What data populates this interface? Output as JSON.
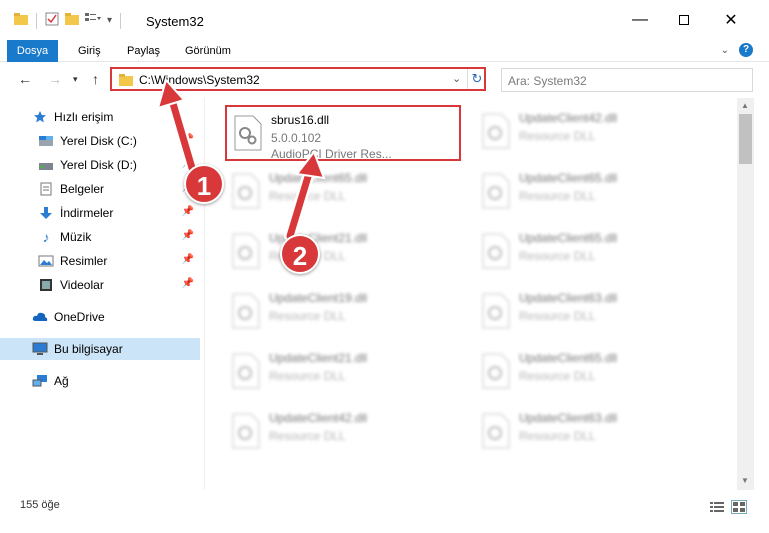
{
  "window": {
    "title": "System32"
  },
  "ribbon": {
    "tabs": [
      "Dosya",
      "Giriş",
      "Paylaş",
      "Görünüm"
    ],
    "help": "?"
  },
  "address": {
    "path": "C:\\Windows\\System32",
    "search_placeholder": "Ara: System32"
  },
  "sidebar": {
    "items": [
      {
        "label": "Hızlı erişim",
        "icon": "star-icon"
      },
      {
        "label": "Yerel Disk (C:)",
        "icon": "drive-icon"
      },
      {
        "label": "Yerel Disk (D:)",
        "icon": "drive-icon"
      },
      {
        "label": "Belgeler",
        "icon": "document-icon"
      },
      {
        "label": "İndirmeler",
        "icon": "download-icon"
      },
      {
        "label": "Müzik",
        "icon": "music-icon"
      },
      {
        "label": "Resimler",
        "icon": "picture-icon"
      },
      {
        "label": "Videolar",
        "icon": "video-icon"
      },
      {
        "label": "OneDrive",
        "icon": "cloud-icon"
      },
      {
        "label": "Bu bilgisayar",
        "icon": "computer-icon"
      },
      {
        "label": "Ağ",
        "icon": "network-icon"
      }
    ]
  },
  "files": [
    {
      "name": "sbrus16.dll",
      "version": "5.0.0.102",
      "desc": "AudioPCI Driver Res..."
    },
    {
      "name": "UpdateClient42.dll",
      "desc": "Resource DLL"
    },
    {
      "name": "UpdateClient65.dll",
      "desc": "Resource DLL"
    },
    {
      "name": "UpdateClient65.dll",
      "desc": "Resource DLL"
    },
    {
      "name": "UpdateClient21.dll",
      "desc": "Resource DLL"
    },
    {
      "name": "UpdateClient65.dll",
      "desc": "Resource DLL"
    },
    {
      "name": "UpdateClient19.dll",
      "desc": "Resource DLL"
    },
    {
      "name": "UpdateClient63.dll",
      "desc": "Resource DLL"
    },
    {
      "name": "UpdateClient21.dll",
      "desc": "Resource DLL"
    },
    {
      "name": "UpdateClient65.dll",
      "desc": "Resource DLL"
    },
    {
      "name": "UpdateClient42.dll",
      "desc": "Resource DLL"
    },
    {
      "name": "UpdateClient63.dll",
      "desc": "Resource DLL"
    }
  ],
  "status": {
    "count": "155 öğe"
  },
  "annotations": {
    "step1": "1",
    "step2": "2"
  },
  "colors": {
    "accent": "#1979ca",
    "highlight": "#d9383a",
    "selected": "#cce4f7"
  }
}
